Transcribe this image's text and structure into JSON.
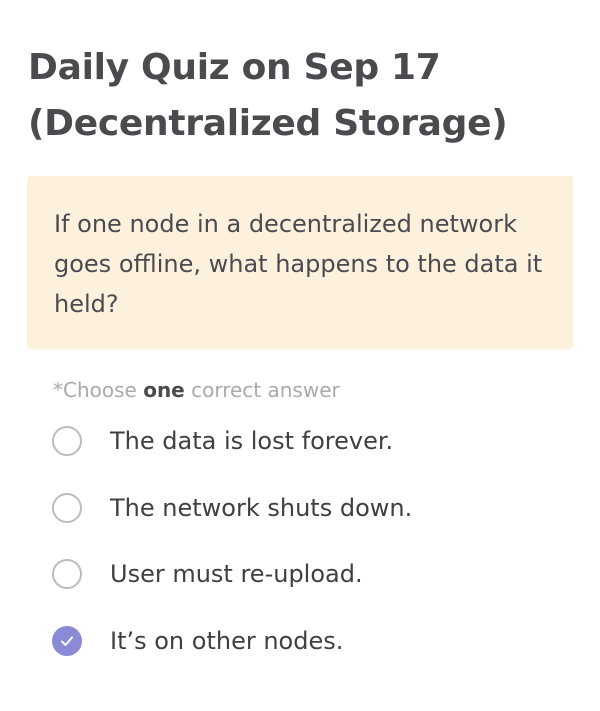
{
  "quiz": {
    "title": "Daily Quiz on Sep 17 (Decentralized Storage)",
    "question": "If one node in a decentralized network goes offline, what happens to the data it held?",
    "instruction": {
      "prefix": "*Choose ",
      "emphasis": "one",
      "suffix": " correct answer"
    },
    "options": [
      {
        "label": "The data is lost forever.",
        "selected": false
      },
      {
        "label": "The network shuts down.",
        "selected": false
      },
      {
        "label": "User must re-upload.",
        "selected": false
      },
      {
        "label": "It’s on other nodes.",
        "selected": true
      }
    ]
  },
  "colors": {
    "question_background": "#fdf1de",
    "selected_accent": "#8a8ad6",
    "radio_border": "#bcbcc0",
    "instruction_muted": "#a9a9ae"
  },
  "icons": {
    "selected_mark": "checkmark-icon",
    "unselected_mark": "empty-radio-circle"
  }
}
